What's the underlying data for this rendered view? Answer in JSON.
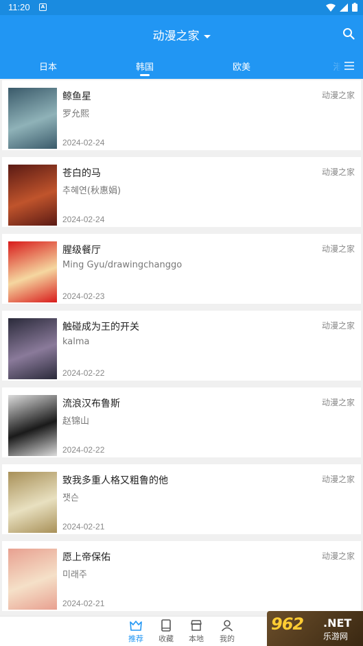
{
  "status_bar": {
    "time": "11:20",
    "notification": "A"
  },
  "app_bar": {
    "title": "动漫之家"
  },
  "tabs": [
    {
      "label": "日本",
      "active": false
    },
    {
      "label": "韩国",
      "active": true
    },
    {
      "label": "欧美",
      "active": false
    },
    {
      "label": "港",
      "active": false
    }
  ],
  "comics": [
    {
      "title": "鲸鱼星",
      "author": "罗允熙",
      "date": "2024-02-24",
      "source": "动漫之家",
      "cover_colors": [
        "#3a5a6a",
        "#8fb2b8"
      ]
    },
    {
      "title": "苍白的马",
      "author": "추혜연(秋惠娟)",
      "date": "2024-02-24",
      "source": "动漫之家",
      "cover_colors": [
        "#5a1a14",
        "#c0542c"
      ]
    },
    {
      "title": "腥级餐厅",
      "author": "Ming Gyu/drawingchanggo",
      "date": "2024-02-23",
      "source": "动漫之家",
      "cover_colors": [
        "#d81b1b",
        "#f5d7a0"
      ]
    },
    {
      "title": "触碰成为王的开关",
      "author": "kalma",
      "date": "2024-02-22",
      "source": "动漫之家",
      "cover_colors": [
        "#2a2a3a",
        "#8a7a9a"
      ]
    },
    {
      "title": "流浪汉布鲁斯",
      "author": "赵锦山",
      "date": "2024-02-22",
      "source": "动漫之家",
      "cover_colors": [
        "#dcdcdc",
        "#1a1a1a"
      ]
    },
    {
      "title": "致我多重人格又粗鲁的他",
      "author": "잿슨",
      "date": "2024-02-21",
      "source": "动漫之家",
      "cover_colors": [
        "#a89058",
        "#e8e0c0"
      ]
    },
    {
      "title": "愿上帝保佑",
      "author": "미래주",
      "date": "2024-02-21",
      "source": "动漫之家",
      "cover_colors": [
        "#e8a090",
        "#f5e0c8"
      ]
    }
  ],
  "bottom_nav": [
    {
      "label": "推荐",
      "icon": "crown-icon",
      "active": true
    },
    {
      "label": "收藏",
      "icon": "book-icon",
      "active": false
    },
    {
      "label": "本地",
      "icon": "store-icon",
      "active": false
    },
    {
      "label": "我的",
      "icon": "person-icon",
      "active": false
    }
  ],
  "watermark": {
    "logo": "962",
    "net": ".NET",
    "sub": "乐游网"
  },
  "colors": {
    "primary": "#2196f3",
    "status_bar": "#1a8be0",
    "background": "#f0f0f0"
  }
}
